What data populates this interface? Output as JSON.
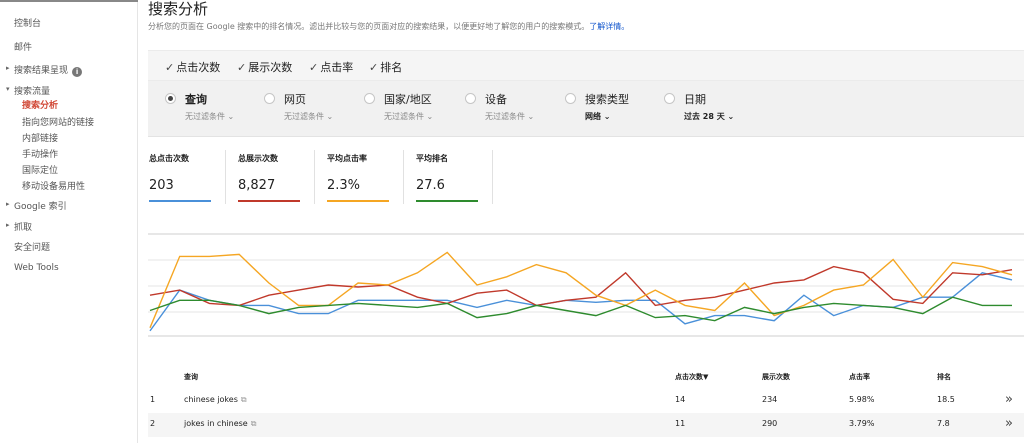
{
  "sidebar": {
    "items": [
      {
        "label": "控制台"
      },
      {
        "label": "邮件"
      },
      {
        "label": "搜索结果呈现"
      },
      {
        "label": "搜索流量"
      },
      {
        "label": "Google 索引"
      },
      {
        "label": "抓取"
      },
      {
        "label": "安全问题"
      },
      {
        "label": "Web Tools"
      }
    ],
    "traffic_sub": [
      {
        "label": "搜索分析"
      },
      {
        "label": "指向您网站的链接"
      },
      {
        "label": "内部链接"
      },
      {
        "label": "手动操作"
      },
      {
        "label": "国际定位"
      },
      {
        "label": "移动设备易用性"
      }
    ]
  },
  "header": {
    "title": "搜索分析",
    "description": "分析您的页面在 Google 搜索中的排名情况。滤出并比较与您的页面对应的搜索结果，以便更好地了解您的用户的搜索模式。",
    "learn_more": "了解详情。"
  },
  "metrics": {
    "clicks": "点击次数",
    "impressions": "展示次数",
    "ctr": "点击率",
    "position": "排名"
  },
  "filters": {
    "query": {
      "label": "查询",
      "sub": "无过滤条件"
    },
    "page": {
      "label": "网页",
      "sub": "无过滤条件"
    },
    "country": {
      "label": "国家/地区",
      "sub": "无过滤条件"
    },
    "device": {
      "label": "设备",
      "sub": "无过滤条件"
    },
    "search_type": {
      "label": "搜索类型",
      "sub": "网络"
    },
    "date": {
      "label": "日期",
      "sub": "过去 28 天"
    }
  },
  "dropdown_caret": "⌄",
  "totals": {
    "clicks": {
      "label": "总点击次数",
      "value": "203",
      "color": "#4a90d9"
    },
    "impressions": {
      "label": "总展示次数",
      "value": "8,827",
      "color": "#c0392b"
    },
    "ctr": {
      "label": "平均点击率",
      "value": "2.3%",
      "color": "#f5a623"
    },
    "position": {
      "label": "平均排名",
      "value": "27.6",
      "color": "#2e8b2e"
    }
  },
  "table": {
    "headers": {
      "query": "查询",
      "clicks": "点击次数▼",
      "impressions": "展示次数",
      "ctr": "点击率",
      "position": "排名"
    },
    "rows": [
      {
        "index": "1",
        "query": "chinese jokes",
        "clicks": "14",
        "impressions": "234",
        "ctr": "5.98%",
        "position": "18.5"
      },
      {
        "index": "2",
        "query": "jokes in chinese",
        "clicks": "11",
        "impressions": "290",
        "ctr": "3.79%",
        "position": "7.8"
      }
    ]
  },
  "chart_data": {
    "type": "line",
    "title": "",
    "xlabel": "",
    "ylabel": "",
    "series": [
      {
        "color": "#4a90d9",
        "values": [
          0.05,
          0.45,
          0.35,
          0.3,
          0.3,
          0.22,
          0.22,
          0.35,
          0.35,
          0.35,
          0.35,
          0.28,
          0.35,
          0.3,
          0.35,
          0.33,
          0.35,
          0.35,
          0.12,
          0.2,
          0.2,
          0.15,
          0.4,
          0.2,
          0.3,
          0.28,
          0.38,
          0.38,
          0.62,
          0.55
        ]
      },
      {
        "color": "#c0392b",
        "values": [
          0.4,
          0.45,
          0.32,
          0.3,
          0.4,
          0.45,
          0.5,
          0.48,
          0.5,
          0.38,
          0.32,
          0.42,
          0.45,
          0.3,
          0.35,
          0.38,
          0.62,
          0.3,
          0.35,
          0.38,
          0.45,
          0.52,
          0.55,
          0.68,
          0.62,
          0.36,
          0.32,
          0.62,
          0.6,
          0.65
        ]
      },
      {
        "color": "#f5a623",
        "values": [
          0.08,
          0.78,
          0.78,
          0.8,
          0.52,
          0.3,
          0.3,
          0.52,
          0.5,
          0.62,
          0.82,
          0.5,
          0.58,
          0.7,
          0.62,
          0.4,
          0.3,
          0.45,
          0.3,
          0.25,
          0.52,
          0.2,
          0.3,
          0.45,
          0.5,
          0.75,
          0.38,
          0.72,
          0.68,
          0.6
        ]
      },
      {
        "color": "#2e8b2e",
        "values": [
          0.25,
          0.35,
          0.35,
          0.3,
          0.22,
          0.28,
          0.3,
          0.32,
          0.3,
          0.28,
          0.32,
          0.18,
          0.22,
          0.3,
          0.25,
          0.2,
          0.3,
          0.18,
          0.2,
          0.15,
          0.28,
          0.22,
          0.28,
          0.32,
          0.3,
          0.28,
          0.22,
          0.38,
          0.3,
          0.3
        ]
      }
    ]
  }
}
